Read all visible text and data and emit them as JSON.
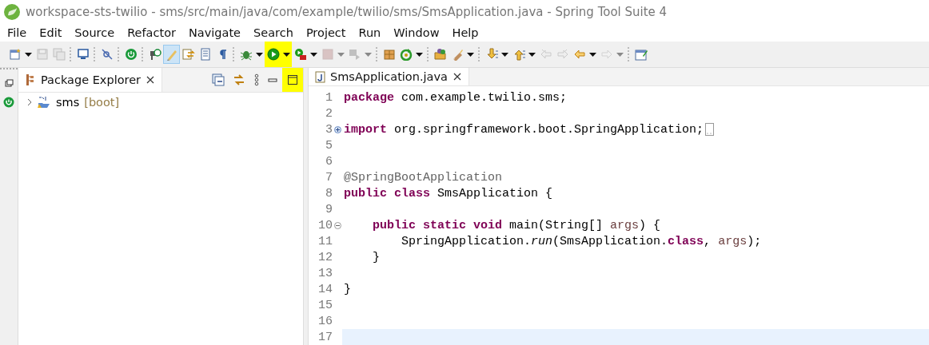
{
  "window": {
    "title": "workspace-sts-twilio - sms/src/main/java/com/example/twilio/sms/SmsApplication.java - Spring Tool Suite 4"
  },
  "menu": [
    "File",
    "Edit",
    "Source",
    "Refactor",
    "Navigate",
    "Search",
    "Project",
    "Run",
    "Window",
    "Help"
  ],
  "toolbar": [
    {
      "kind": "button",
      "dropdown": true,
      "disabled": false,
      "pressed": false,
      "highlighted": false
    },
    {
      "kind": "button",
      "dropdown": false,
      "disabled": true,
      "pressed": false,
      "highlighted": false
    },
    {
      "kind": "button",
      "dropdown": false,
      "disabled": true,
      "pressed": false,
      "highlighted": false
    },
    {
      "kind": "separator"
    },
    {
      "kind": "button",
      "dropdown": false,
      "disabled": false,
      "pressed": false,
      "highlighted": false
    },
    {
      "kind": "separator"
    },
    {
      "kind": "button",
      "dropdown": false,
      "disabled": false,
      "pressed": false,
      "highlighted": false
    },
    {
      "kind": "separator"
    },
    {
      "kind": "button",
      "dropdown": false,
      "disabled": false,
      "pressed": false,
      "highlighted": false
    },
    {
      "kind": "separator"
    },
    {
      "kind": "button",
      "dropdown": false,
      "disabled": false,
      "pressed": false,
      "highlighted": false
    },
    {
      "kind": "button",
      "dropdown": false,
      "disabled": false,
      "pressed": true,
      "highlighted": false
    },
    {
      "kind": "button",
      "dropdown": false,
      "disabled": false,
      "pressed": false,
      "highlighted": false
    },
    {
      "kind": "button",
      "dropdown": false,
      "disabled": false,
      "pressed": false,
      "highlighted": false
    },
    {
      "kind": "button",
      "dropdown": false,
      "disabled": false,
      "pressed": false,
      "highlighted": false
    },
    {
      "kind": "separator"
    },
    {
      "kind": "button",
      "dropdown": true,
      "disabled": false,
      "pressed": false,
      "highlighted": false
    },
    {
      "kind": "button",
      "dropdown": true,
      "disabled": false,
      "pressed": false,
      "highlighted": true
    },
    {
      "kind": "button",
      "dropdown": true,
      "disabled": false,
      "pressed": false,
      "highlighted": false
    },
    {
      "kind": "button",
      "dropdown": true,
      "disabled": true,
      "pressed": false,
      "highlighted": false
    },
    {
      "kind": "button",
      "dropdown": true,
      "disabled": true,
      "pressed": false,
      "highlighted": false
    },
    {
      "kind": "separator"
    },
    {
      "kind": "button",
      "dropdown": false,
      "disabled": false,
      "pressed": false,
      "highlighted": false
    },
    {
      "kind": "button",
      "dropdown": true,
      "disabled": false,
      "pressed": false,
      "highlighted": false
    },
    {
      "kind": "separator"
    },
    {
      "kind": "button",
      "dropdown": false,
      "disabled": false,
      "pressed": false,
      "highlighted": false
    },
    {
      "kind": "button",
      "dropdown": true,
      "disabled": false,
      "pressed": false,
      "highlighted": false
    },
    {
      "kind": "separator"
    },
    {
      "kind": "button",
      "dropdown": true,
      "disabled": false,
      "pressed": false,
      "highlighted": false
    },
    {
      "kind": "button",
      "dropdown": true,
      "disabled": false,
      "pressed": false,
      "highlighted": false
    },
    {
      "kind": "button",
      "dropdown": false,
      "disabled": true,
      "pressed": false,
      "highlighted": false
    },
    {
      "kind": "button",
      "dropdown": false,
      "disabled": true,
      "pressed": false,
      "highlighted": false
    },
    {
      "kind": "button",
      "dropdown": true,
      "disabled": false,
      "pressed": false,
      "highlighted": false
    },
    {
      "kind": "button",
      "dropdown": true,
      "disabled": true,
      "pressed": false,
      "highlighted": false
    },
    {
      "kind": "separator"
    },
    {
      "kind": "button",
      "dropdown": false,
      "disabled": false,
      "pressed": false,
      "highlighted": false
    }
  ],
  "package_explorer": {
    "title": "Package Explorer",
    "maximize_highlighted": true,
    "tree": [
      {
        "label": "sms",
        "decoration": "[boot]",
        "expanded": false
      }
    ]
  },
  "editor": {
    "tabs": [
      {
        "label": "SmsApplication.java",
        "selected": true
      }
    ],
    "lines": [
      {
        "number": "1",
        "tokens": [
          {
            "kind": "keyword",
            "text": "package"
          },
          {
            "kind": "plain",
            "text": " com.example.twilio.sms;"
          }
        ]
      },
      {
        "number": "2"
      },
      {
        "number": "3",
        "folded": true,
        "tokens": [
          {
            "kind": "keyword",
            "text": "import"
          },
          {
            "kind": "plain",
            "text": " org.springframework.boot.SpringApplication;"
          }
        ]
      },
      {
        "number": "5"
      },
      {
        "number": "6"
      },
      {
        "number": "7",
        "tokens": [
          {
            "kind": "annotation",
            "text": "@SpringBootApplication"
          }
        ]
      },
      {
        "number": "8",
        "tokens": [
          {
            "kind": "keyword",
            "text": "public "
          },
          {
            "kind": "keyword",
            "text": "class"
          },
          {
            "kind": "plain",
            "text": " SmsApplication {"
          }
        ]
      },
      {
        "number": "9"
      },
      {
        "number": "10",
        "folded": false,
        "tokens": [
          {
            "kind": "keyword",
            "text": "    public static void"
          },
          {
            "kind": "plain",
            "text": " main(String[] "
          },
          {
            "kind": "variable",
            "text": "args"
          },
          {
            "kind": "plain",
            "text": ") {"
          }
        ]
      },
      {
        "number": "11",
        "tokens": [
          {
            "kind": "plain",
            "text": "        SpringApplication."
          },
          {
            "kind": "method",
            "text": "run"
          },
          {
            "kind": "plain",
            "text": "(SmsApplication."
          },
          {
            "kind": "keyword",
            "text": "class"
          },
          {
            "kind": "plain",
            "text": ", "
          },
          {
            "kind": "variable",
            "text": "args"
          },
          {
            "kind": "plain",
            "text": ");"
          }
        ]
      },
      {
        "number": "12",
        "tokens": [
          {
            "kind": "plain",
            "text": "    }"
          }
        ]
      },
      {
        "number": "13"
      },
      {
        "number": "14",
        "tokens": [
          {
            "kind": "plain",
            "text": "}"
          }
        ]
      },
      {
        "number": "15"
      },
      {
        "number": "16"
      },
      {
        "number": "17",
        "current": true
      }
    ]
  }
}
